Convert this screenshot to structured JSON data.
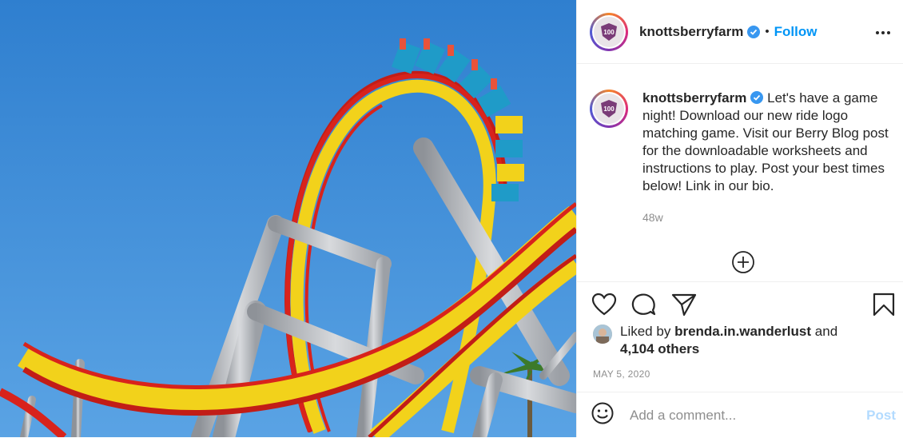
{
  "header": {
    "username": "knottsberryfarm",
    "separator": "•",
    "follow_label": "Follow",
    "avatar_badge": "100"
  },
  "caption": {
    "username": "knottsberryfarm",
    "text": "Let's have a game night! Download our new ride logo matching game. Visit our Berry Blog post for the downloadable worksheets and instructions to play. Post your best times below! Link in our bio.",
    "time": "48w"
  },
  "likes": {
    "prefix": "Liked by",
    "user": "brenda.in.wanderlust",
    "and": "and",
    "others": "4,104 others"
  },
  "date": "MAY 5, 2020",
  "comment": {
    "placeholder": "Add a comment...",
    "post_label": "Post"
  },
  "colors": {
    "accent": "#0095f6",
    "post_disabled": "#b3dbff",
    "verified": "#3897f0",
    "sky": "#3f8fd6",
    "track_yellow": "#f2d21b",
    "track_red": "#d8231c",
    "support_gray": "#b9bcc2"
  },
  "icons": [
    "more-options-icon",
    "verified-icon",
    "add-icon",
    "heart-icon",
    "comment-icon",
    "share-icon",
    "bookmark-icon",
    "emoji-icon"
  ]
}
